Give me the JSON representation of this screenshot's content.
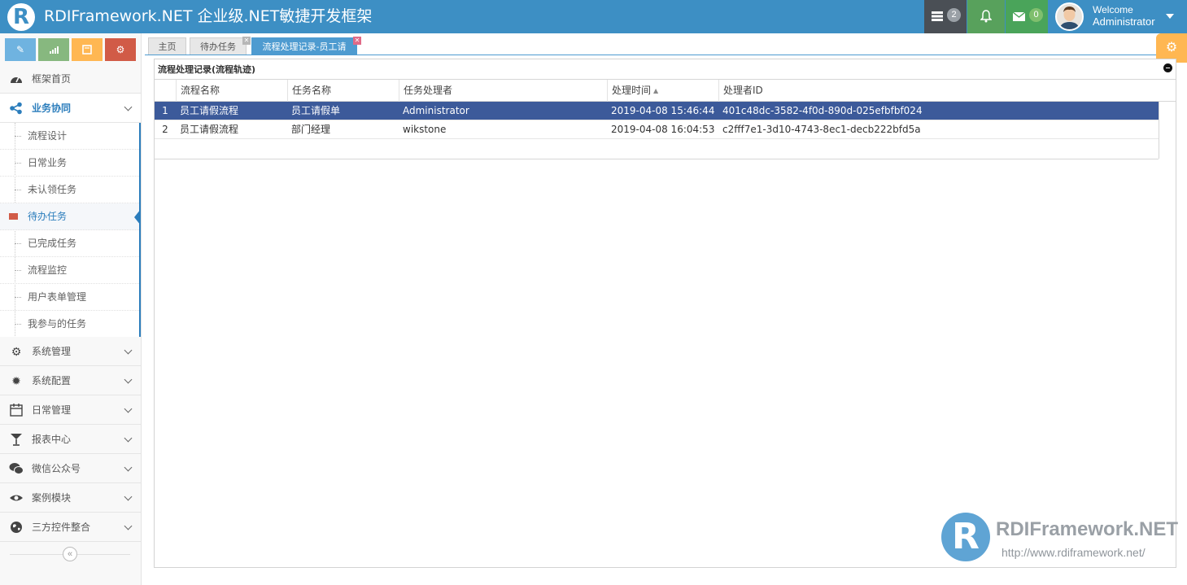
{
  "header": {
    "logo_letter": "R",
    "title": "RDIFramework.NET 企业级.NET敏捷开发框架",
    "tasks_badge": "2",
    "mail_badge": "0",
    "welcome": "Welcome",
    "username": "Administrator",
    "icons": {
      "tasks": "tasks-icon",
      "bell": "bell-icon",
      "mail": "envelope-icon",
      "caret": "caret-down-icon"
    }
  },
  "sidebar": {
    "shortcuts": [
      {
        "icon": "pencil-icon",
        "color": "#6fb3e0"
      },
      {
        "icon": "signal-icon",
        "color": "#87b87f"
      },
      {
        "icon": "book-icon",
        "color": "#ffb752"
      },
      {
        "icon": "cogs-icon",
        "color": "#d15b47"
      }
    ],
    "home": "框架首页",
    "business": "业务协同",
    "sub_items": [
      "流程设计",
      "日常业务",
      "未认领任务",
      "待办任务",
      "已完成任务",
      "流程监控",
      "用户表单管理",
      "我参与的任务"
    ],
    "menus": [
      "系统管理",
      "系统配置",
      "日常管理",
      "报表中心",
      "微信公众号",
      "案例模块",
      "三方控件整合"
    ],
    "collapse": "«"
  },
  "tabs": [
    {
      "label": "主页",
      "closable": false
    },
    {
      "label": "待办任务",
      "closable": true
    },
    {
      "label": "流程处理记录-员工请",
      "closable": true,
      "active": true
    }
  ],
  "panel": {
    "title": "流程处理记录(流程轨迹)",
    "columns": [
      "流程名称",
      "任务名称",
      "任务处理者",
      "处理时间",
      "处理者ID"
    ],
    "rows": [
      {
        "num": "1",
        "process": "员工请假流程",
        "task": "员工请假单",
        "handler": "Administrator",
        "time": "2019-04-08 15:46:44",
        "handler_id": "401c48dc-3582-4f0d-890d-025efbfbf024"
      },
      {
        "num": "2",
        "process": "员工请假流程",
        "task": "部门经理",
        "handler": "wikstone",
        "time": "2019-04-08 16:04:53",
        "handler_id": "c2fff7e1-3d10-4743-8ec1-decb222bfd5a"
      }
    ]
  },
  "watermark": {
    "letter": "R",
    "name": "RDIFramework.NET",
    "url": "http://www.rdiframework.net/"
  },
  "colors": {
    "header_bg": "#3d8fc4",
    "accent": "#2b7dbc",
    "selected_row": "#3c5a9a",
    "active_tab": "#4e9bd0"
  }
}
